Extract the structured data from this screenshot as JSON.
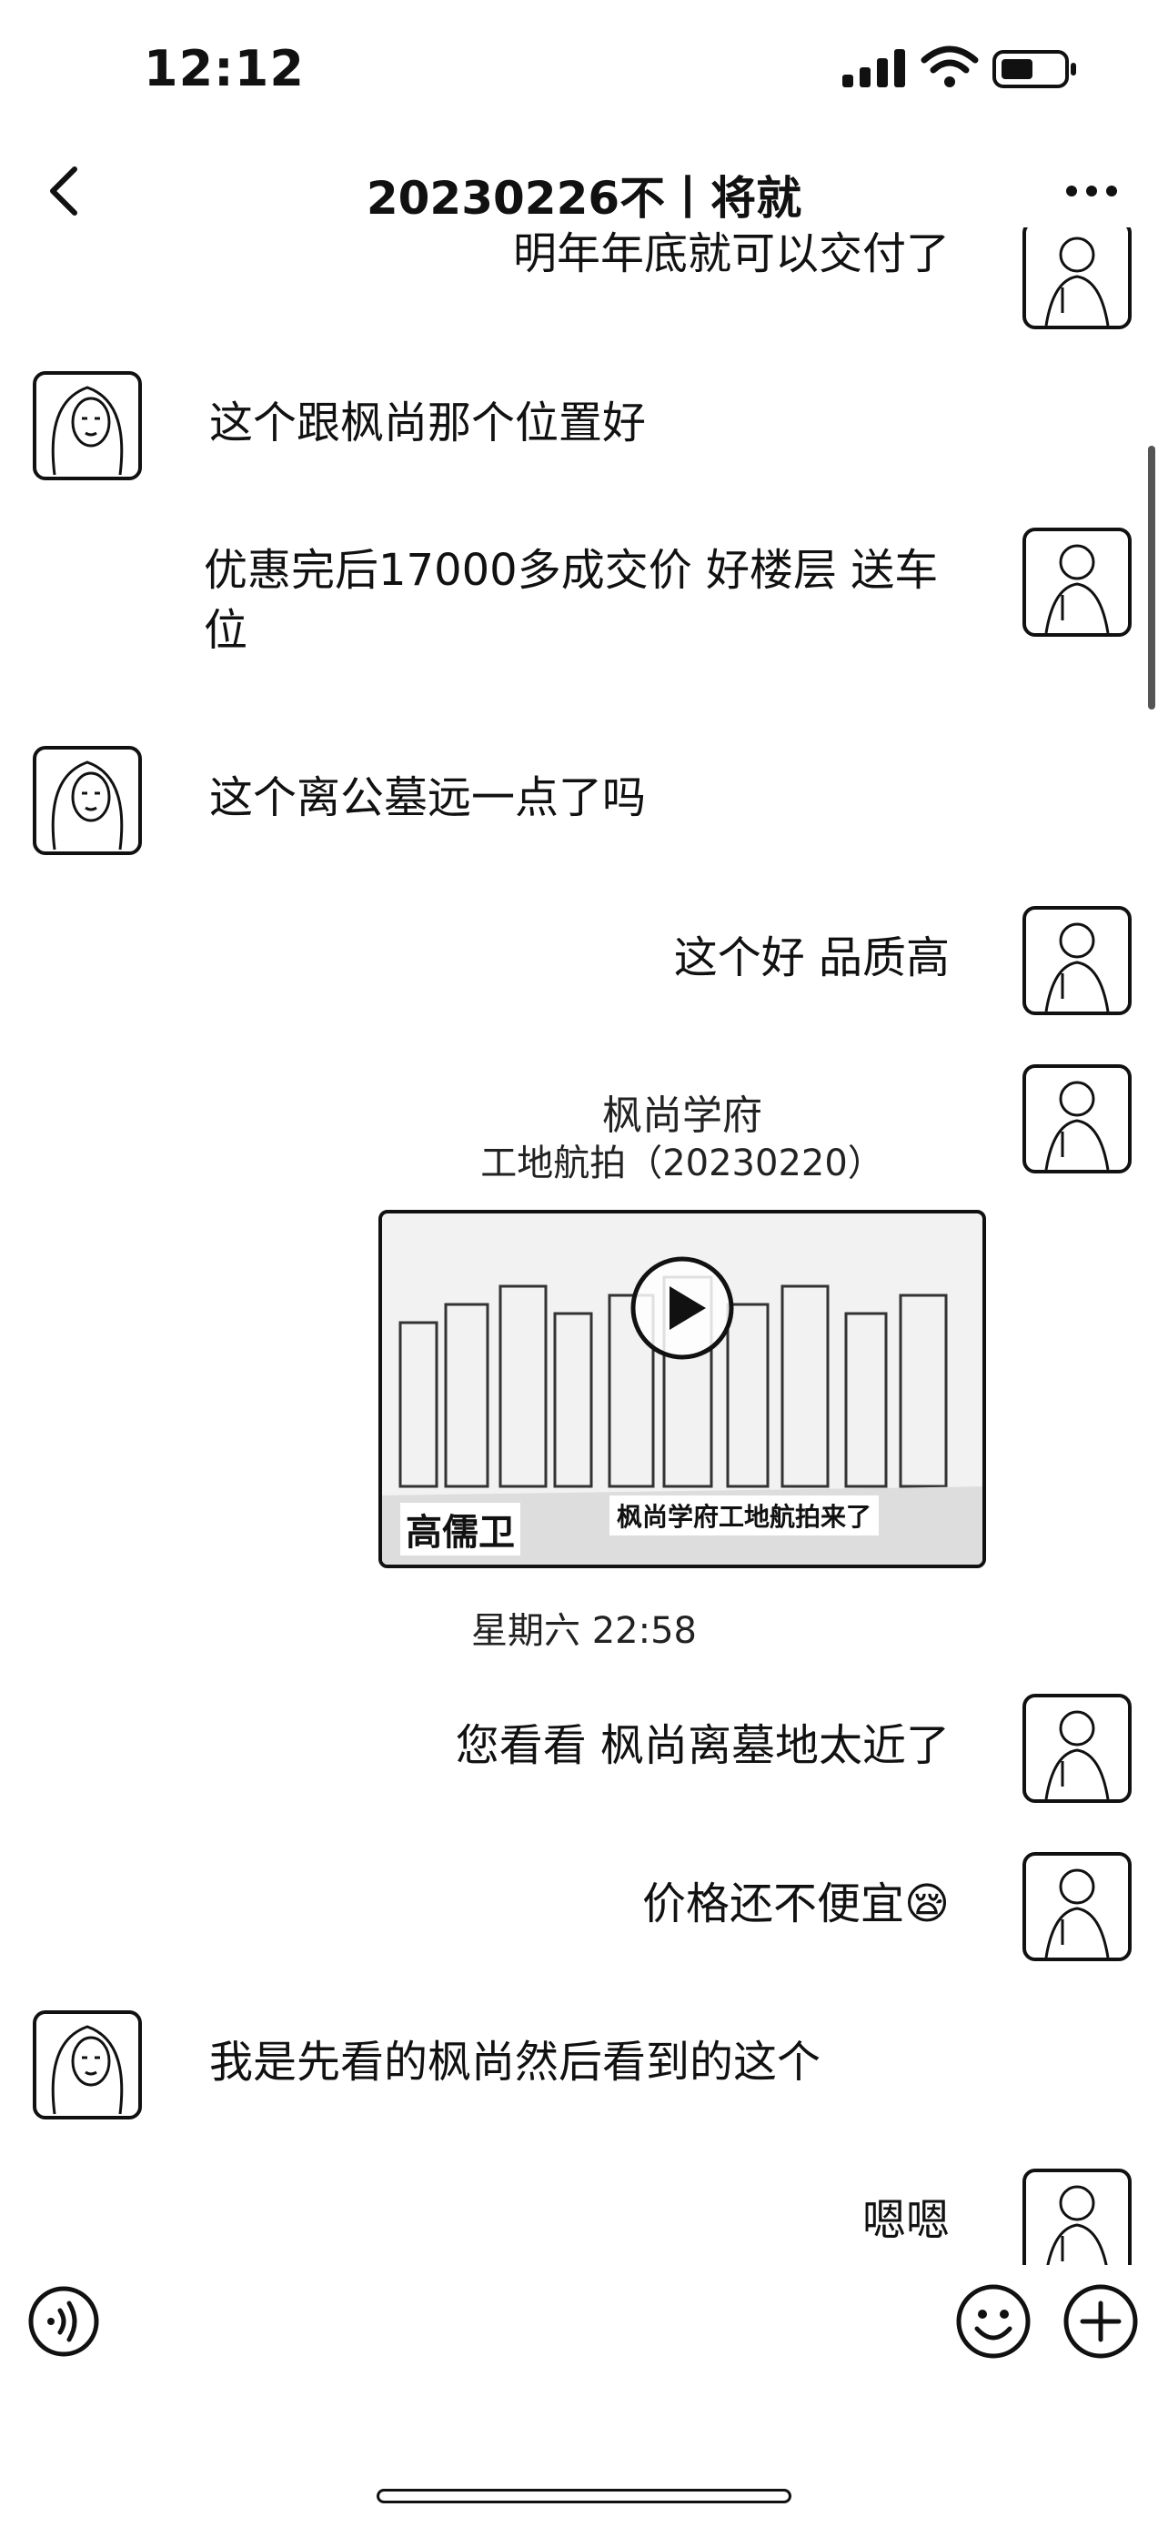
{
  "status_bar": {
    "time": "12:12"
  },
  "header": {
    "title": "20230226不丨将就"
  },
  "messages": [
    {
      "side": "mine",
      "text": "明年年底就可以交付了"
    },
    {
      "side": "theirs",
      "text": "这个跟枫尚那个位置好"
    },
    {
      "side": "mine",
      "text": "优惠完后17000多成交价 好楼层 送车位"
    },
    {
      "side": "theirs",
      "text": "这个离公墓远一点了吗"
    },
    {
      "side": "mine",
      "text": "这个好 品质高"
    },
    {
      "side": "mine",
      "text": "您看看 枫尚离墓地太近了"
    },
    {
      "side": "mine",
      "text": "价格还不便宜😪"
    },
    {
      "side": "theirs",
      "text": "我是先看的枫尚然后看到的这个"
    },
    {
      "side": "mine",
      "text": "嗯嗯"
    }
  ],
  "video": {
    "title": "枫尚学府",
    "subtitle": "工地航拍（20230220）",
    "caption": "枫尚学府工地航拍来了",
    "author": "高儒卫"
  },
  "timestamp": "星期六 22:58"
}
